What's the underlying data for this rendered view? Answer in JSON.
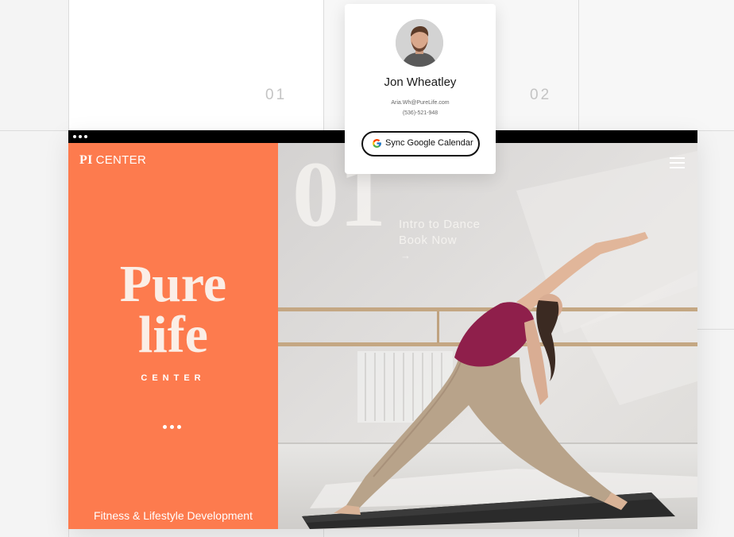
{
  "calendar": {
    "day_1": "01",
    "day_2": "02"
  },
  "profile": {
    "name": "Jon Wheatley",
    "email": "Aria.Wh@PureLife.com",
    "phone": "(536)-521-948",
    "sync_button": "Sync Google Calendar",
    "sync_icon": "google-icon"
  },
  "site": {
    "logo_mark": "PI",
    "logo_text": "CENTER",
    "hero_title_line1": "Pure",
    "hero_title_line2": "life",
    "hero_subtitle": "CENTER",
    "tagline": "Fitness & Lifestyle Development",
    "class_number": "01",
    "class_title": "Intro to Dance",
    "class_cta": "Book Now",
    "arrow_icon": "arrow-right-icon",
    "menu_icon": "hamburger-menu-icon"
  },
  "colors": {
    "accent": "#fd7b4e",
    "browser_bar": "#000000",
    "card": "#ffffff"
  }
}
